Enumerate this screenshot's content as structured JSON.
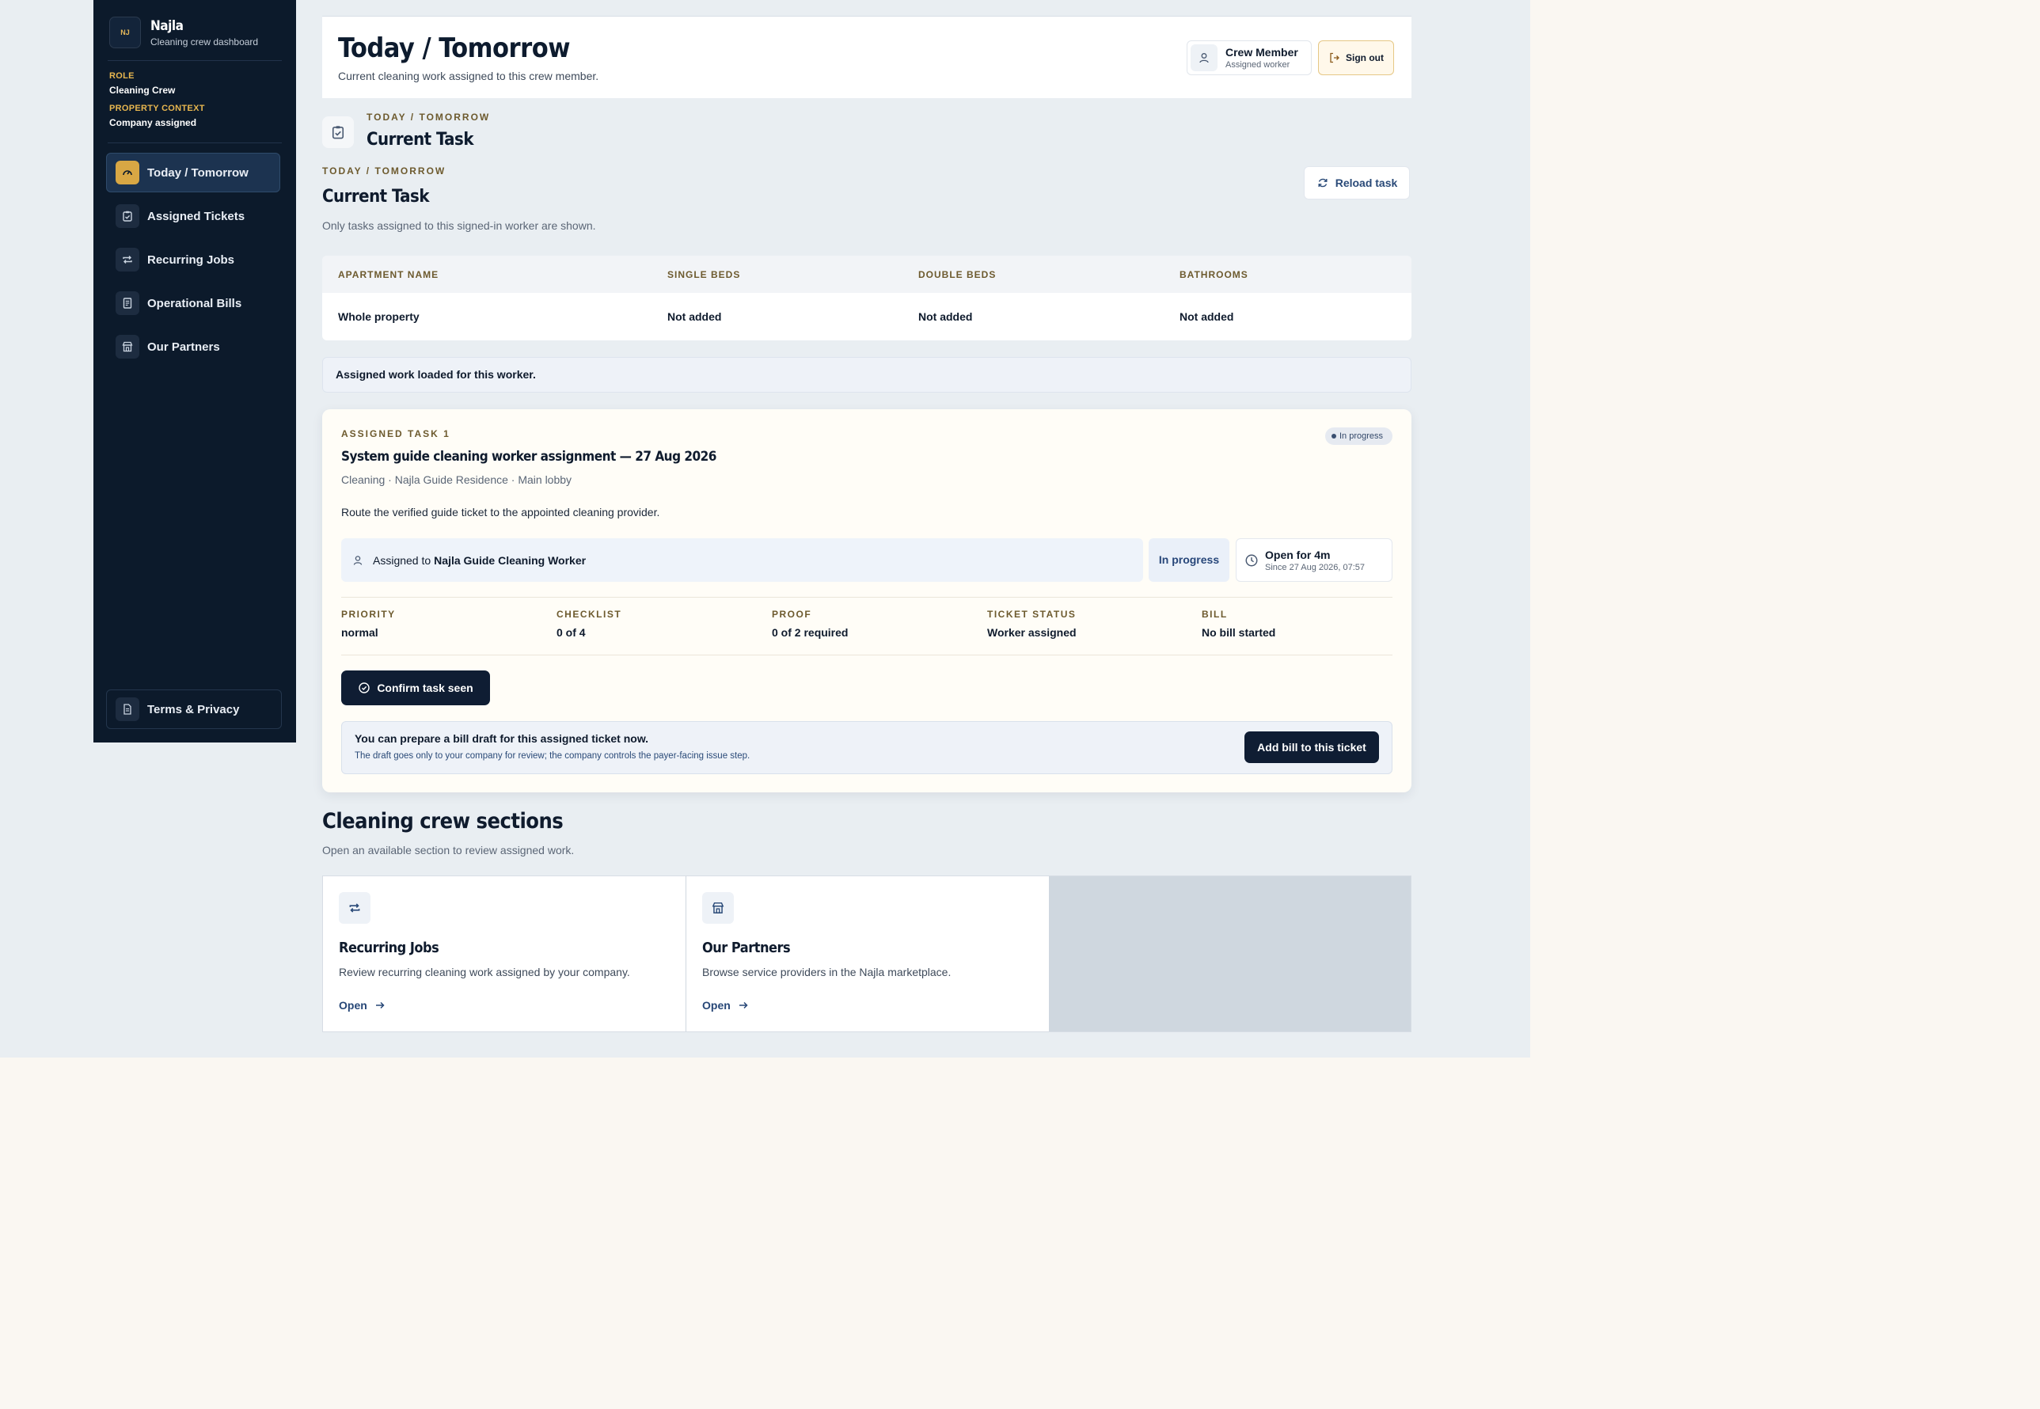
{
  "brand": {
    "name": "Najla",
    "subtitle": "Cleaning crew dashboard",
    "logo_text": "NJ"
  },
  "context": {
    "role_label": "ROLE",
    "role_value": "Cleaning Crew",
    "property_label": "PROPERTY CONTEXT",
    "property_value": "Company assigned"
  },
  "nav": [
    {
      "label": "Today / Tomorrow",
      "icon": "gauge-icon",
      "active": true
    },
    {
      "label": "Assigned Tickets",
      "icon": "clipboard-check-icon"
    },
    {
      "label": "Recurring Jobs",
      "icon": "repeat-icon"
    },
    {
      "label": "Operational Bills",
      "icon": "receipt-icon"
    },
    {
      "label": "Our Partners",
      "icon": "store-icon"
    }
  ],
  "terms_label": "Terms & Privacy",
  "header": {
    "title": "Today / Tomorrow",
    "subtitle": "Current cleaning work assigned to this crew member.",
    "user_name": "Crew Member",
    "user_role": "Assigned worker",
    "signout_label": "Sign out"
  },
  "section": {
    "eyebrow": "TODAY / TOMORROW",
    "title": "Current Task",
    "eyebrow2": "TODAY / TOMORROW",
    "title2": "Current Task",
    "subtitle": "Only tasks assigned to this signed-in worker are shown.",
    "reload_label": "Reload task"
  },
  "property_table": {
    "headers": [
      "APARTMENT NAME",
      "SINGLE BEDS",
      "DOUBLE BEDS",
      "BATHROOMS"
    ],
    "row": [
      "Whole property",
      "Not added",
      "Not added",
      "Not added"
    ]
  },
  "loaded_message": "Assigned work loaded for this worker.",
  "task": {
    "eyebrow": "ASSIGNED TASK 1",
    "badge": "In progress",
    "title": "System guide cleaning worker assignment — 27 Aug 2026",
    "meta": "Cleaning · Najla Guide Residence · Main lobby",
    "description": "Route the verified guide ticket to the appointed cleaning provider.",
    "assigned_prefix": "Assigned to",
    "assignee": "Najla Guide Cleaning Worker",
    "status": "In progress",
    "open_for": "Open for 4m",
    "since": "Since 27 Aug 2026, 07:57",
    "stats": [
      {
        "label": "PRIORITY",
        "value": "normal"
      },
      {
        "label": "CHECKLIST",
        "value": "0 of 4"
      },
      {
        "label": "PROOF",
        "value": "0 of 2 required"
      },
      {
        "label": "TICKET STATUS",
        "value": "Worker assigned"
      },
      {
        "label": "BILL",
        "value": "No bill started"
      }
    ],
    "confirm_label": "Confirm task seen",
    "bill_title": "You can prepare a bill draft for this assigned ticket now.",
    "bill_sub": "The draft goes only to your company for review; the company controls the payer-facing issue step.",
    "add_bill_label": "Add bill to this ticket"
  },
  "sections": {
    "title": "Cleaning crew sections",
    "subtitle": "Open an available section to review assigned work.",
    "cards": [
      {
        "title": "Recurring Jobs",
        "desc": "Review recurring cleaning work assigned by your company.",
        "open": "Open",
        "icon": "repeat-icon"
      },
      {
        "title": "Our Partners",
        "desc": "Browse service providers in the Najla marketplace.",
        "open": "Open",
        "icon": "store-icon"
      }
    ]
  },
  "colors": {
    "sidebar_bg": "#0c1a2b",
    "accent_gold": "#d8a744",
    "eyebrow": "#6d5a2e",
    "primary_btn": "#0f1d33"
  }
}
